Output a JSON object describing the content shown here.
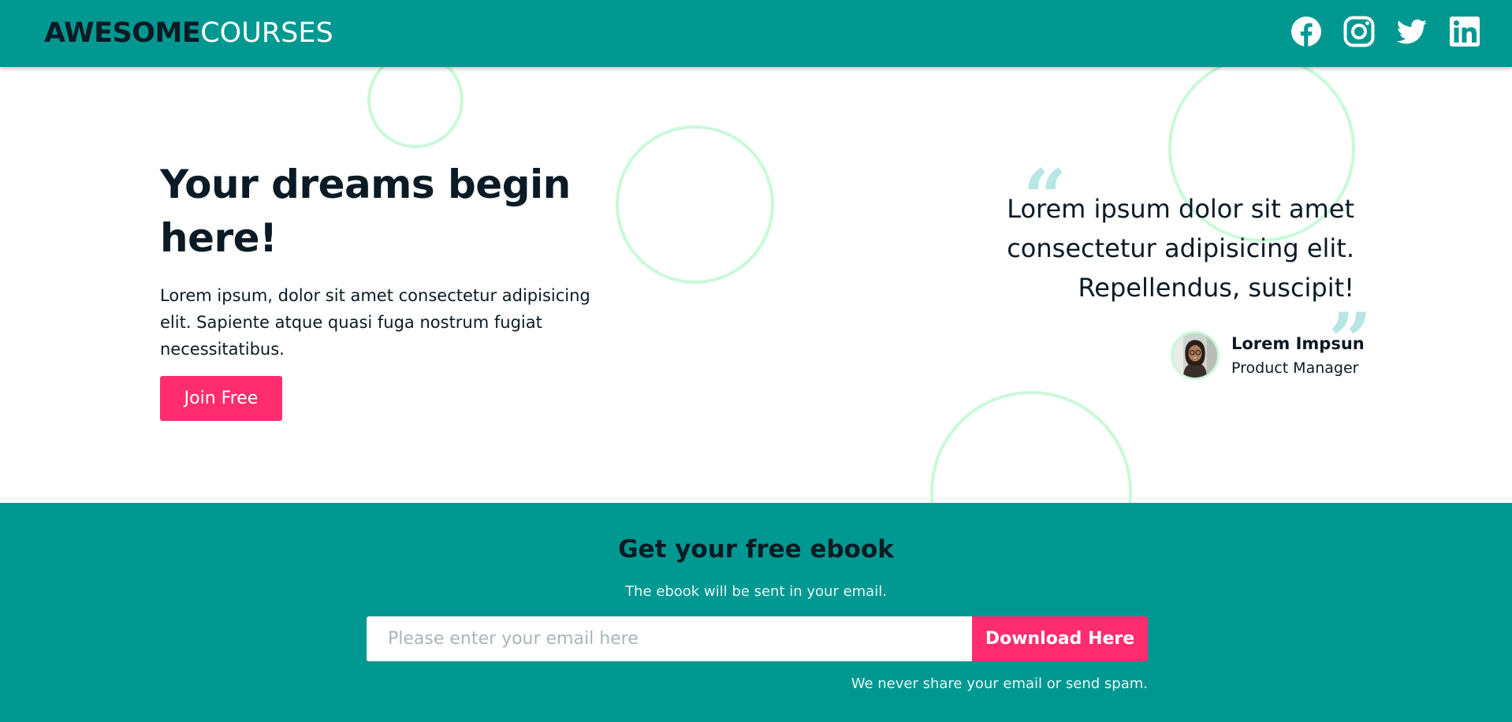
{
  "header": {
    "logo_bold": "AWESOME",
    "logo_light": "COURSES",
    "socials": [
      {
        "name": "facebook-icon"
      },
      {
        "name": "instagram-icon"
      },
      {
        "name": "twitter-icon"
      },
      {
        "name": "linkedin-icon"
      }
    ]
  },
  "hero": {
    "title": "Your dreams begin here!",
    "description": "Lorem ipsum, dolor sit amet consectetur adipisicing elit. Sapiente atque quasi fuga nostrum fugiat necessitatibus.",
    "cta_label": "Join Free"
  },
  "testimonial": {
    "quote": "Lorem ipsum dolor sit amet consectetur adipisicing elit. Repellendus, suscipit!",
    "author_name": "Lorem Impsun",
    "author_role": "Product Manager"
  },
  "ebook": {
    "title": "Get your free ebook",
    "subtitle": "The ebook will be sent in your email.",
    "email_placeholder": "Please enter your email here",
    "email_value": "",
    "button_label": "Download Here",
    "disclaimer": "We never share your email or send spam."
  },
  "colors": {
    "brand_teal": "#009890",
    "accent_pink": "#ff2d6f",
    "dark_text": "#0b1a24",
    "circle_mint": "#c9f9d9"
  }
}
